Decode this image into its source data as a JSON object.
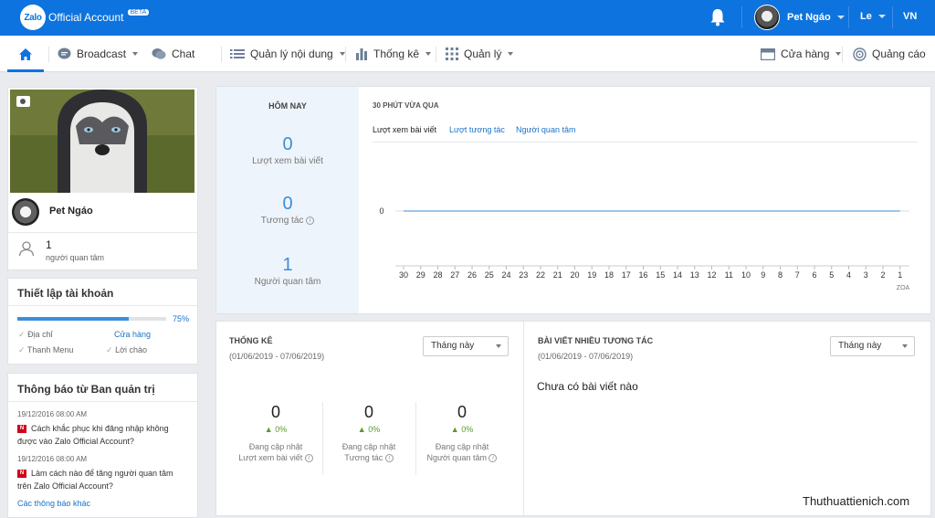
{
  "topbar": {
    "logo_mark": "Zalo",
    "logo_text": "Official Account",
    "beta_label": "BETA",
    "user_name": "Pet Ngáo",
    "account_menu": "Le",
    "language": "VN"
  },
  "nav": {
    "broadcast": "Broadcast",
    "chat": "Chat",
    "content": "Quản lý nội dung",
    "stats": "Thống kê",
    "manage": "Quản lý",
    "store": "Cửa hàng",
    "ads": "Quảng cáo"
  },
  "profile": {
    "name": "Pet Ngáo",
    "followers_count": "1",
    "followers_label": "người quan tâm"
  },
  "setup": {
    "title": "Thiết lập tài khoản",
    "progress_label": "75%",
    "progress": 0.75,
    "items": [
      "Địa chỉ",
      "Cửa hàng",
      "Thanh Menu",
      "Lời chào"
    ]
  },
  "notices": {
    "title": "Thông báo từ Ban quản trị",
    "items": [
      {
        "date": "19/12/2016 08:00 AM",
        "text1": "Cách khắc phục khi đăng nhập không",
        "text2": "được vào Zalo Official Account?"
      },
      {
        "date": "19/12/2016 08:00 AM",
        "text1": "Làm cách nào để tăng người quan tâm",
        "text2": "trên Zalo Official Account?"
      }
    ],
    "more": "Các thông báo khác"
  },
  "today": {
    "title": "HÔM NAY",
    "views_value": "0",
    "views_label": "Lượt xem bài viết",
    "interactions_value": "0",
    "interactions_label": "Tương tác",
    "followers_value": "1",
    "followers_label": "Người quan tâm"
  },
  "recent": {
    "title": "30 PHÚT VỪA QUA",
    "tabs": [
      "Lượt xem bài viết",
      "Lượt tương tác",
      "Người quan tâm"
    ],
    "unit": "ZOA"
  },
  "chart_data": {
    "type": "line",
    "x": [
      30,
      29,
      28,
      27,
      26,
      25,
      24,
      23,
      22,
      21,
      20,
      19,
      18,
      17,
      16,
      15,
      14,
      13,
      12,
      11,
      10,
      9,
      8,
      7,
      6,
      5,
      4,
      3,
      2,
      1
    ],
    "series": [
      {
        "values": [
          0,
          0,
          0,
          0,
          0,
          0,
          0,
          0,
          0,
          0,
          0,
          0,
          0,
          0,
          0,
          0,
          0,
          0,
          0,
          0,
          0,
          0,
          0,
          0,
          0,
          0,
          0,
          0,
          0,
          0
        ]
      }
    ],
    "yticks": [
      0
    ],
    "xlabel": "ZOA"
  },
  "stats": {
    "title": "THỐNG KÊ",
    "range": "(01/06/2019 - 07/06/2019)",
    "period": "Tháng này",
    "cols": [
      {
        "value": "0",
        "change": "0%",
        "status": "Đang cập nhật",
        "label": "Lượt xem bài viết"
      },
      {
        "value": "0",
        "change": "0%",
        "status": "Đang cập nhật",
        "label": "Tương tác"
      },
      {
        "value": "0",
        "change": "0%",
        "status": "Đang cập nhật",
        "label": "Người quan tâm"
      }
    ]
  },
  "top_posts": {
    "title": "BÀI VIẾT NHIỀU TƯƠNG TÁC",
    "range": "(01/06/2019 - 07/06/2019)",
    "period": "Tháng này",
    "empty": "Chưa có bài viết nào"
  },
  "watermark": "Thuthuattienich.com"
}
